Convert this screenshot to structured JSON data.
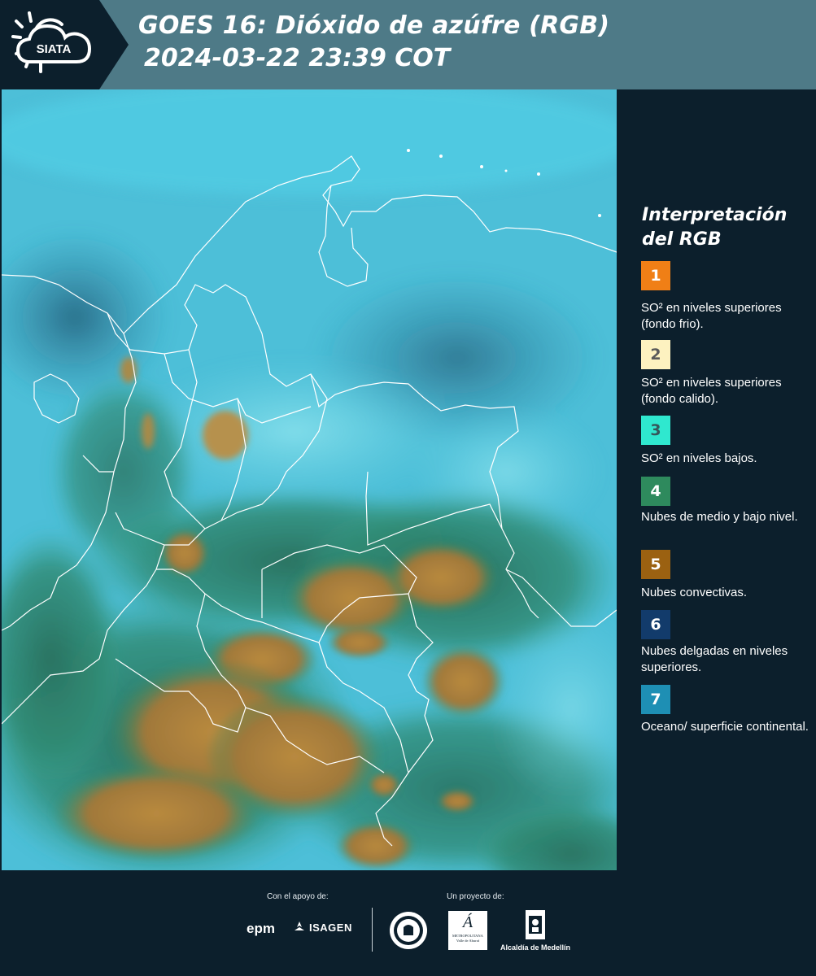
{
  "header": {
    "logo_text": "SIATA",
    "title": "GOES 16: Dióxido de azúfre (RGB)",
    "timestamp": "2024-03-22 23:39 COT"
  },
  "map": {
    "product": "SO2 RGB",
    "colors": {
      "ocean_land": "#4ec3dc",
      "low_so2_cyan": "#5fd6e4",
      "mid_low_clouds": "#2c7d68",
      "convective": "#a47a35",
      "thin_high_clouds": "#1b4a6b",
      "borders": "#ffffff"
    }
  },
  "legend": {
    "title_line1": "Interpretación",
    "title_line2": "del RGB",
    "items": [
      {
        "number": "1",
        "color": "#f07f16",
        "number_color": "#ffffff",
        "text": "SO² en niveles superiores (fondo frio)."
      },
      {
        "number": "2",
        "color": "#fdf2c0",
        "number_color": "#5a5a5a",
        "text": "SO² en niveles superiores (fondo calido)."
      },
      {
        "number": "3",
        "color": "#2fe8cf",
        "number_color": "#35575a",
        "text": "SO² en niveles bajos."
      },
      {
        "number": "4",
        "color": "#2e8a5d",
        "number_color": "#ffffff",
        "text": "Nubes de medio y bajo nivel."
      },
      {
        "number": "5",
        "color": "#9b6111",
        "number_color": "#ffffff",
        "text": "Nubes convectivas."
      },
      {
        "number": "6",
        "color": "#123b6b",
        "number_color": "#ffffff",
        "text": "Nubes delgadas en niveles superiores."
      },
      {
        "number": "7",
        "color": "#1e8fb4",
        "number_color": "#ffffff",
        "text": "Oceano/ superficie continental."
      }
    ]
  },
  "footer": {
    "support_label": "Con el apoyo de:",
    "project_label": "Un proyecto de:",
    "logo_epm": "epm",
    "logo_isagen": "ISAGEN",
    "logo_area_line1": "METROPOLITANA",
    "logo_area_line2": "Valle de Aburrá",
    "logo_alcaldia": "Alcaldía de Medellín"
  }
}
